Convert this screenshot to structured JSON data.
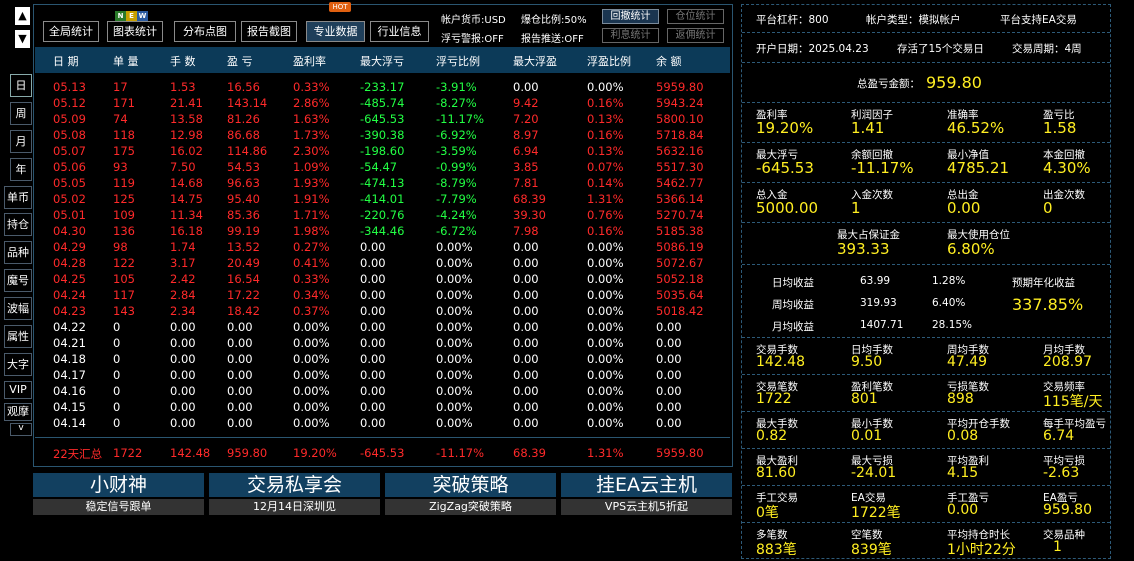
{
  "nav": {
    "up": "▲",
    "down": "▼",
    "periods": [
      "日",
      "周",
      "月",
      "年"
    ],
    "side": [
      "单币",
      "持仓",
      "品种",
      "魔号",
      "波幅",
      "属性",
      "大字",
      "VIP",
      "观摩"
    ],
    "more": "v"
  },
  "toolbar": {
    "buttons": [
      "全局统计",
      "图表统计",
      "分布点图",
      "报告截图",
      "专业数据",
      "行业信息"
    ],
    "new_badge": "NEW",
    "hot_badge": "HOT",
    "currency": "帐户货币:USD",
    "margin_ratio": "爆仓比例:50%",
    "float_alert": "浮亏警报:OFF",
    "report_push": "报告推送:OFF",
    "mini": [
      "回撤统计",
      "仓位统计",
      "利息统计",
      "返佣统计"
    ]
  },
  "table": {
    "headers": [
      "日 期",
      "单 量",
      "手 数",
      "盈 亏",
      "盈利率",
      "最大浮亏",
      "浮亏比例",
      "最大浮盈",
      "浮盈比例",
      "余 额"
    ],
    "rows": [
      [
        "05.13",
        "17",
        "1.53",
        "16.56",
        "0.33%",
        "-233.17",
        "-3.91%",
        "0.00",
        "0.00%",
        "5959.80",
        "r"
      ],
      [
        "05.12",
        "171",
        "21.41",
        "143.14",
        "2.86%",
        "-485.74",
        "-8.27%",
        "9.42",
        "0.16%",
        "5943.24",
        "r"
      ],
      [
        "05.09",
        "74",
        "13.58",
        "81.26",
        "1.63%",
        "-645.53",
        "-11.17%",
        "7.20",
        "0.13%",
        "5800.10",
        "r"
      ],
      [
        "05.08",
        "118",
        "12.98",
        "86.68",
        "1.73%",
        "-390.38",
        "-6.92%",
        "8.97",
        "0.16%",
        "5718.84",
        "r"
      ],
      [
        "05.07",
        "175",
        "16.02",
        "114.86",
        "2.30%",
        "-198.60",
        "-3.59%",
        "6.94",
        "0.13%",
        "5632.16",
        "r"
      ],
      [
        "05.06",
        "93",
        "7.50",
        "54.53",
        "1.09%",
        "-54.47",
        "-0.99%",
        "3.85",
        "0.07%",
        "5517.30",
        "r"
      ],
      [
        "05.05",
        "119",
        "14.68",
        "96.63",
        "1.93%",
        "-474.13",
        "-8.79%",
        "7.81",
        "0.14%",
        "5462.77",
        "r"
      ],
      [
        "05.02",
        "125",
        "14.75",
        "95.40",
        "1.91%",
        "-414.01",
        "-7.79%",
        "68.39",
        "1.31%",
        "5366.14",
        "r"
      ],
      [
        "05.01",
        "109",
        "11.34",
        "85.36",
        "1.71%",
        "-220.76",
        "-4.24%",
        "39.30",
        "0.76%",
        "5270.74",
        "r"
      ],
      [
        "04.30",
        "136",
        "16.18",
        "99.19",
        "1.98%",
        "-344.46",
        "-6.72%",
        "7.98",
        "0.16%",
        "5185.38",
        "r"
      ],
      [
        "04.29",
        "98",
        "1.74",
        "13.52",
        "0.27%",
        "0.00",
        "0.00%",
        "0.00",
        "0.00%",
        "5086.19",
        "r"
      ],
      [
        "04.28",
        "122",
        "3.17",
        "20.49",
        "0.41%",
        "0.00",
        "0.00%",
        "0.00",
        "0.00%",
        "5072.67",
        "r"
      ],
      [
        "04.25",
        "105",
        "2.42",
        "16.54",
        "0.33%",
        "0.00",
        "0.00%",
        "0.00",
        "0.00%",
        "5052.18",
        "r"
      ],
      [
        "04.24",
        "117",
        "2.84",
        "17.22",
        "0.34%",
        "0.00",
        "0.00%",
        "0.00",
        "0.00%",
        "5035.64",
        "r"
      ],
      [
        "04.23",
        "143",
        "2.34",
        "18.42",
        "0.37%",
        "0.00",
        "0.00%",
        "0.00",
        "0.00%",
        "5018.42",
        "r"
      ],
      [
        "04.22",
        "0",
        "0.00",
        "0.00",
        "0.00%",
        "0.00",
        "0.00%",
        "0.00",
        "0.00%",
        "0.00",
        "w"
      ],
      [
        "04.21",
        "0",
        "0.00",
        "0.00",
        "0.00%",
        "0.00",
        "0.00%",
        "0.00",
        "0.00%",
        "0.00",
        "w"
      ],
      [
        "04.18",
        "0",
        "0.00",
        "0.00",
        "0.00%",
        "0.00",
        "0.00%",
        "0.00",
        "0.00%",
        "0.00",
        "w"
      ],
      [
        "04.17",
        "0",
        "0.00",
        "0.00",
        "0.00%",
        "0.00",
        "0.00%",
        "0.00",
        "0.00%",
        "0.00",
        "w"
      ],
      [
        "04.16",
        "0",
        "0.00",
        "0.00",
        "0.00%",
        "0.00",
        "0.00%",
        "0.00",
        "0.00%",
        "0.00",
        "w"
      ],
      [
        "04.15",
        "0",
        "0.00",
        "0.00",
        "0.00%",
        "0.00",
        "0.00%",
        "0.00",
        "0.00%",
        "0.00",
        "w"
      ],
      [
        "04.14",
        "0",
        "0.00",
        "0.00",
        "0.00%",
        "0.00",
        "0.00%",
        "0.00",
        "0.00%",
        "0.00",
        "w"
      ]
    ],
    "summary": [
      "22天汇总",
      "1722",
      "142.48",
      "959.80",
      "19.20%",
      "-645.53",
      "-11.17%",
      "68.39",
      "1.31%",
      "5959.80"
    ]
  },
  "banners": [
    [
      "小财神",
      "稳定信号跟单"
    ],
    [
      "交易私享会",
      "12月14日深圳见"
    ],
    [
      "突破策略",
      "ZigZag突破策略"
    ],
    [
      "挂EA云主机",
      "VPS云主机5折起"
    ]
  ],
  "right": {
    "r1": [
      "平台杠杆：800",
      "帐户类型：模拟帐户",
      "平台支持EA交易"
    ],
    "r2": [
      "开户日期：2025.04.23",
      "存活了15个交易日",
      "交易周期：4周"
    ],
    "total_label": "总盈亏金额：",
    "total_value": "959.80",
    "grid1": [
      [
        "盈利率",
        "19.20%"
      ],
      [
        "利润因子",
        "1.41"
      ],
      [
        "准确率",
        "46.52%"
      ],
      [
        "盈亏比",
        "1.58"
      ],
      [
        "最大浮亏",
        "-645.53"
      ],
      [
        "余额回撤",
        "-11.17%"
      ],
      [
        "最小净值",
        "4785.21"
      ],
      [
        "本金回撤",
        "4.30%"
      ],
      [
        "总入金",
        "5000.00"
      ],
      [
        "入金次数",
        "1"
      ],
      [
        "总出金",
        "0.00"
      ],
      [
        "出金次数",
        "0"
      ]
    ],
    "margin": [
      [
        "最大占保证金",
        "393.33"
      ],
      [
        "最大使用仓位",
        "6.80%"
      ]
    ],
    "income": [
      [
        "日均收益",
        "63.99",
        "1.28%"
      ],
      [
        "周均收益",
        "319.93",
        "6.40%"
      ],
      [
        "月均收益",
        "1407.71",
        "28.15%"
      ]
    ],
    "annual_label": "预期年化收益",
    "annual_value": "337.85%",
    "grid2": [
      [
        "交易手数",
        "142.48"
      ],
      [
        "日均手数",
        "9.50"
      ],
      [
        "周均手数",
        "47.49"
      ],
      [
        "月均手数",
        "208.97"
      ],
      [
        "交易笔数",
        "1722"
      ],
      [
        "盈利笔数",
        "801"
      ],
      [
        "亏损笔数",
        "898"
      ],
      [
        "交易频率",
        "115笔/天"
      ],
      [
        "最大手数",
        "0.82"
      ],
      [
        "最小手数",
        "0.01"
      ],
      [
        "平均开仓手数",
        "0.08"
      ],
      [
        "每手平均盈亏",
        "6.74"
      ],
      [
        "最大盈利",
        "81.60"
      ],
      [
        "最大亏损",
        "-24.01"
      ],
      [
        "平均盈利",
        "4.15"
      ],
      [
        "平均亏损",
        "-2.63"
      ],
      [
        "手工交易",
        "0笔"
      ],
      [
        "EA交易",
        "1722笔"
      ],
      [
        "手工盈亏",
        "0.00"
      ],
      [
        "EA盈亏",
        "959.80"
      ],
      [
        "多笔数",
        "883笔"
      ],
      [
        "空笔数",
        "839笔"
      ],
      [
        "平均持仓时长",
        "1小时22分"
      ],
      [
        "交易品种",
        "1"
      ]
    ]
  }
}
